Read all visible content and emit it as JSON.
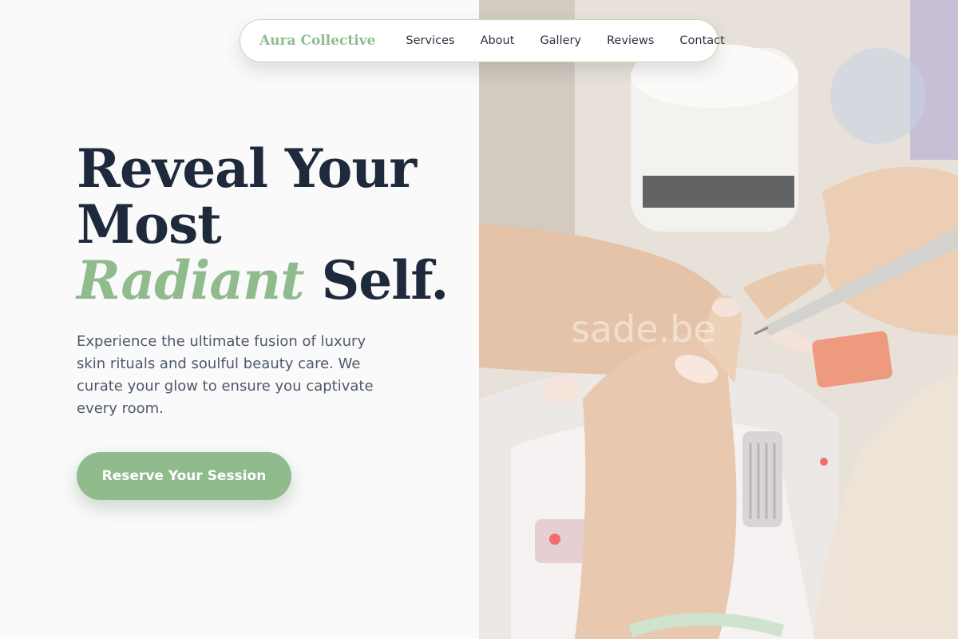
{
  "nav": {
    "brand": "Aura Collective",
    "links": [
      "Services",
      "About",
      "Gallery",
      "Reviews",
      "Contact"
    ]
  },
  "hero": {
    "headline_line1": "Reveal Your",
    "headline_line2": "Most",
    "headline_accent": "Radiant",
    "headline_end": " Self.",
    "subtext": "Experience the ultimate fusion of luxury skin rituals and soulful beauty care. We curate your glow to ensure you captivate every room.",
    "cta_label": "Reserve Your Session"
  },
  "photo": {
    "watermark": "sade.be"
  },
  "colors": {
    "accent": "#8fbb8d",
    "heading": "#1e2a3c",
    "body_text": "#4d5968",
    "background": "#fafafb"
  }
}
